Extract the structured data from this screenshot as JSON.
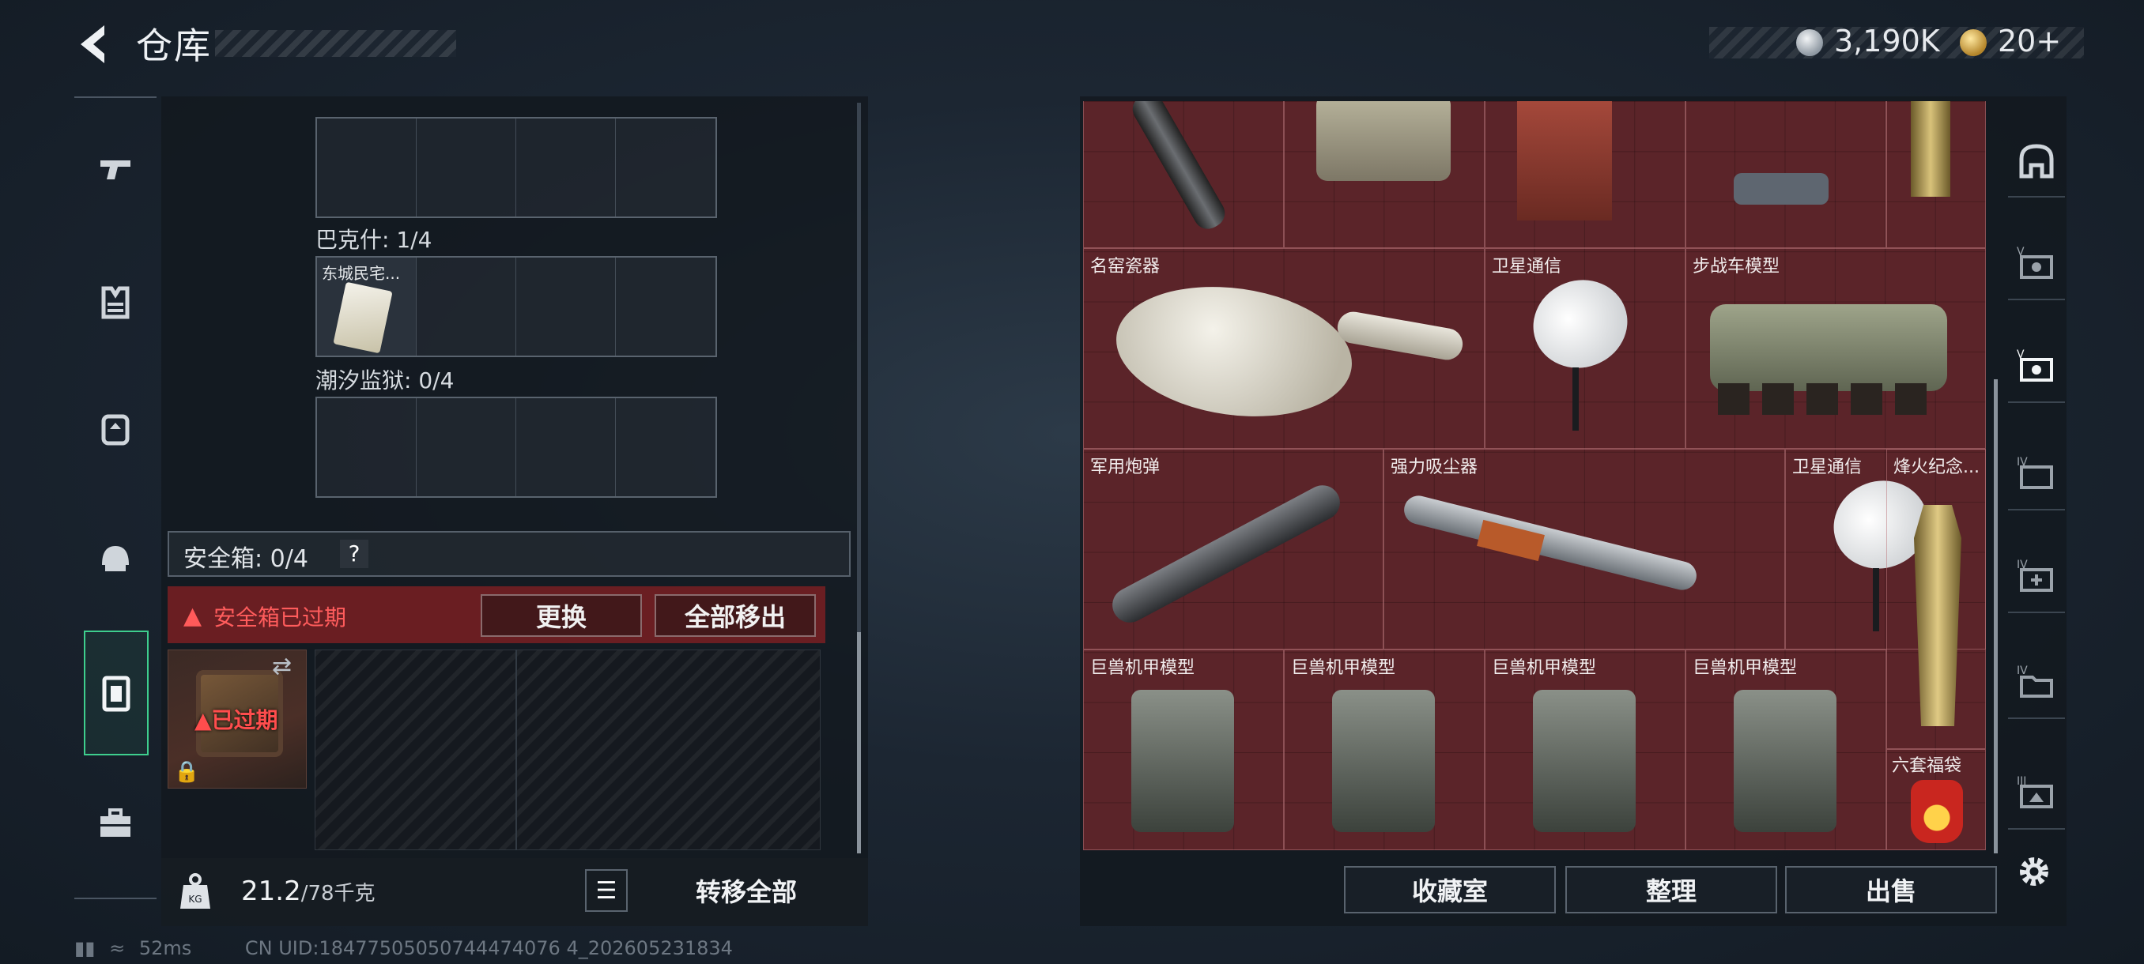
{
  "header": {
    "title": "仓库",
    "silver_amount": "3,190K",
    "gold_amount": "20+"
  },
  "colors": {
    "accent_green": "#3ecf8e",
    "warning_red": "#ff5c5c",
    "grid_bg": "#5b2429"
  },
  "left_panel": {
    "sections": [
      {
        "label": "巴克什: 1/4",
        "first_item": "东城民宅..."
      },
      {
        "label": "潮汐监狱: 0/4"
      }
    ],
    "safebox": {
      "label": "安全箱: 0/4",
      "help": "?",
      "expired_text": "安全箱已过期",
      "replace_label": "更换",
      "move_all_label": "全部移出",
      "expired_badge": "已过期"
    },
    "footer": {
      "weight": "21.2",
      "weight_max": "/78千克",
      "transfer_all_label": "转移全部"
    }
  },
  "right_panel": {
    "items": [
      {
        "name": "名窑瓷器"
      },
      {
        "name": "卫星通信"
      },
      {
        "name": "步战车模型"
      },
      {
        "name": "军用炮弹"
      },
      {
        "name": "强力吸尘器"
      },
      {
        "name": "卫星通信"
      },
      {
        "name": "烽火纪念..."
      },
      {
        "name": "巨兽机甲模型"
      },
      {
        "name": "巨兽机甲模型"
      },
      {
        "name": "巨兽机甲模型"
      },
      {
        "name": "巨兽机甲模型"
      },
      {
        "name": "六套福袋"
      }
    ],
    "buttons": {
      "collection": "收藏室",
      "sort": "整理",
      "sell": "出售"
    }
  },
  "right_nav": {
    "tabs": [
      "vault-icon",
      "case-v-icon",
      "case-v-active-icon",
      "case-iv-icon",
      "case-iv-add-icon",
      "case-iv-folder-icon",
      "case-iii-icon"
    ]
  },
  "status": {
    "ping": "52ms",
    "uid": "CN UID:18477505050744474076 4_202605231834"
  }
}
